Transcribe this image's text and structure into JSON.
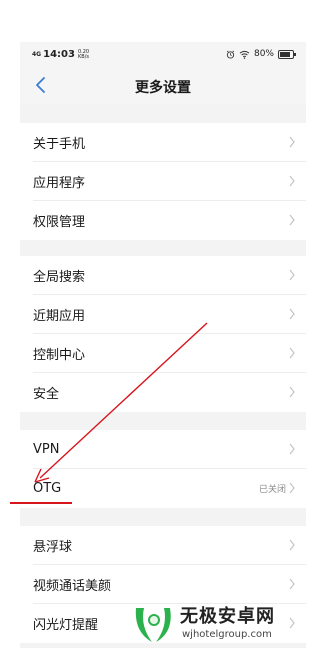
{
  "status_bar": {
    "signal_tag": "4G",
    "time": "14:03",
    "speed_value": "0.20",
    "speed_unit": "KB/s",
    "battery_text": "80%",
    "battery_level": 0.8
  },
  "nav": {
    "title": "更多设置",
    "back_icon": "chevron-left-icon"
  },
  "groups": [
    {
      "items": [
        {
          "label": "关于手机"
        },
        {
          "label": "应用程序"
        },
        {
          "label": "权限管理"
        }
      ]
    },
    {
      "items": [
        {
          "label": "全局搜索"
        },
        {
          "label": "近期应用"
        },
        {
          "label": "控制中心"
        },
        {
          "label": "安全"
        }
      ]
    },
    {
      "items": [
        {
          "label": "VPN"
        },
        {
          "label": "OTG",
          "value": "已关闭"
        }
      ]
    },
    {
      "items": [
        {
          "label": "悬浮球"
        },
        {
          "label": "视频通话美颜"
        },
        {
          "label": "闪光灯提醒"
        }
      ]
    }
  ],
  "annotation": {
    "color": "#d8141c"
  },
  "watermark": {
    "title": "无极安卓网",
    "url": "wjhotelgroup.com",
    "logo_colors": [
      "#2bb24c",
      "#e8f6ea"
    ]
  }
}
